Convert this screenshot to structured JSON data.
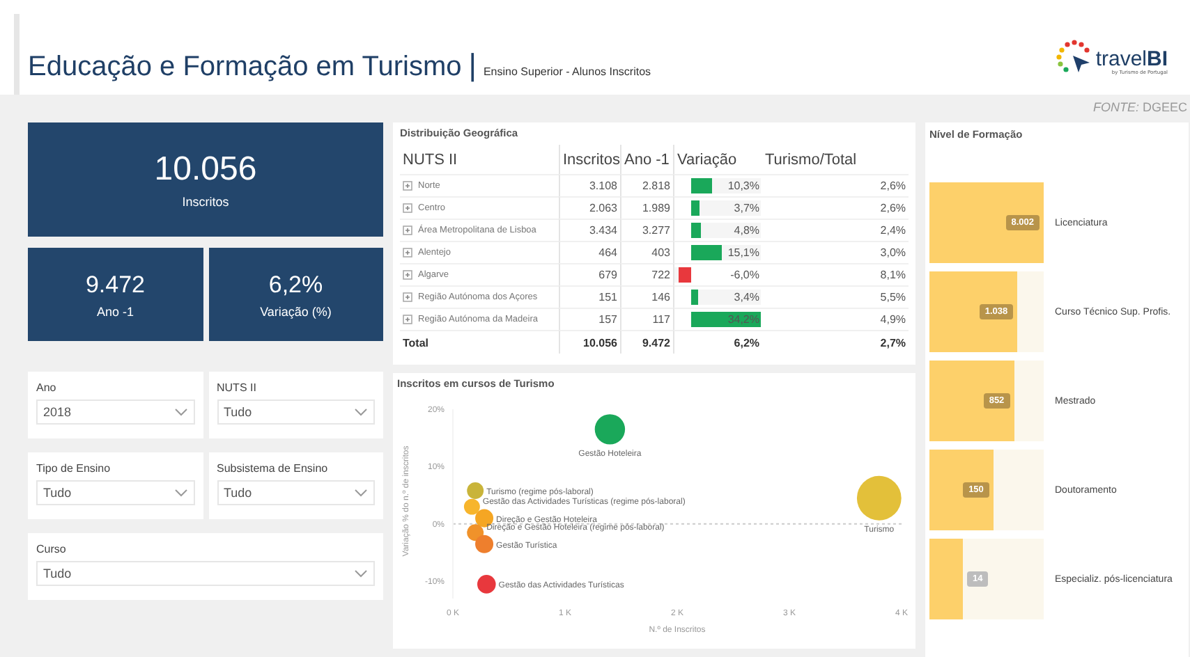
{
  "header": {
    "title": "Educação e Formação em Turismo",
    "separator": "|",
    "subtitle": "Ensino Superior - Alunos Inscritos",
    "logo": "travel**BI**",
    "logo_tagline": "by Turismo de Portugal",
    "source": "*FONTE:* DGEEC"
  },
  "kpis": {
    "main": {
      "value": "10.056",
      "label": "Inscritos"
    },
    "small": [
      {
        "value": "9.472",
        "label": "Ano -1"
      },
      {
        "value": "6,2%",
        "label": "Variação (%)"
      }
    ]
  },
  "filters": [
    {
      "label": "Ano",
      "value": "2018",
      "wide": false
    },
    {
      "label": "NUTS II",
      "value": "Tudo",
      "wide": false
    },
    {
      "label": "Tipo de Ensino",
      "value": "Tudo",
      "wide": false
    },
    {
      "label": "Subsistema de Ensino",
      "value": "Tudo",
      "wide": false
    },
    {
      "label": "Curso",
      "value": "Tudo",
      "wide": true
    }
  ],
  "geo_table": {
    "title": "Distribuição Geográfica",
    "columns": [
      "NUTS II",
      "Inscritos",
      "Ano -1",
      "Variação",
      "Turismo/Total"
    ],
    "rows": [
      {
        "name": "Norte",
        "inscritos": "3.108",
        "ano_anterior": "2.818",
        "variacao": "10,3%",
        "level": 0.3,
        "negative": false,
        "turismo_total": "2,6%"
      },
      {
        "name": "Centro",
        "inscritos": "2.063",
        "ano_anterior": "1.989",
        "variacao": "3,7%",
        "level": 0.11,
        "negative": false,
        "turismo_total": "2,6%"
      },
      {
        "name": "Área Metropolitana de Lisboa",
        "inscritos": "3.434",
        "ano_anterior": "3.277",
        "variacao": "4,8%",
        "level": 0.14,
        "negative": false,
        "turismo_total": "2,4%"
      },
      {
        "name": "Alentejo",
        "inscritos": "464",
        "ano_anterior": "403",
        "variacao": "15,1%",
        "level": 0.44,
        "negative": false,
        "turismo_total": "3,0%"
      },
      {
        "name": "Algarve",
        "inscritos": "679",
        "ano_anterior": "722",
        "variacao": "-6,0%",
        "level": 0.75,
        "negative": true,
        "turismo_total": "8,1%"
      },
      {
        "name": "Região Autónoma dos Açores",
        "inscritos": "151",
        "ano_anterior": "146",
        "variacao": "3,4%",
        "level": 0.1,
        "negative": false,
        "turismo_total": "5,5%"
      },
      {
        "name": "Região Autónoma da Madeira",
        "inscritos": "157",
        "ano_anterior": "117",
        "variacao": "34,2%",
        "level": 1,
        "negative": false,
        "turismo_total": "4,9%"
      }
    ],
    "total": {
      "name": "Total",
      "inscritos": "10.056",
      "ano_anterior": "9.472",
      "variacao": "6,2%",
      "turismo_total": "2,7%"
    }
  },
  "scatter": {
    "chart_data": {
      "type": "scatter",
      "title": "Inscritos em cursos de Turismo",
      "xlabel": "N.º de Inscritos",
      "ylabel": "Variação % do n.º de inscritos",
      "x": [
        1400,
        3800,
        200,
        170,
        280,
        200,
        280,
        300
      ],
      "series": [
        {
          "name": "Gestão Hoteleira",
          "color": "#1aa85a",
          "values": [
            16.5,
            null,
            null,
            null,
            null,
            null,
            null,
            null
          ]
        },
        {
          "name": "Turismo",
          "color": "#e3c03a",
          "values": [
            null,
            4.5,
            null,
            null,
            null,
            null,
            null,
            null
          ]
        },
        {
          "name": "Turismo (regime pós-laboral)",
          "color": "#c9b43a",
          "values": [
            null,
            null,
            5.8,
            null,
            null,
            null,
            null,
            null
          ]
        },
        {
          "name": "Gestão das Actividades Turísticas (regime pós-laboral)",
          "color": "#f7b52c",
          "values": [
            null,
            null,
            null,
            3,
            null,
            null,
            null,
            null
          ]
        },
        {
          "name": "Direção e Gestão Hoteleira",
          "color": "#f5a623",
          "values": [
            null,
            null,
            null,
            null,
            1,
            null,
            null,
            null
          ]
        },
        {
          "name": "Direção e Gestão Hoteleira (regime pós-laboral)",
          "color": "#f0922a",
          "values": [
            null,
            null,
            null,
            null,
            null,
            -1.5,
            null,
            null
          ]
        },
        {
          "name": "Gestão Turística",
          "color": "#ee7f2d",
          "values": [
            null,
            null,
            null,
            null,
            null,
            null,
            -3.5,
            null
          ]
        },
        {
          "name": "Gestão das Actividades Turísticas",
          "color": "#e8383d",
          "values": [
            null,
            null,
            null,
            null,
            null,
            null,
            null,
            -10.5
          ]
        }
      ],
      "xlim": [
        0,
        4000
      ],
      "ylim": [
        -13,
        20
      ],
      "xticks": [
        {
          "value": 0,
          "label": "0 K"
        },
        {
          "value": 1000,
          "label": "1 K"
        },
        {
          "value": 2000,
          "label": "2 K"
        },
        {
          "value": 3000,
          "label": "3 K"
        },
        {
          "value": 4000,
          "label": "4 K"
        }
      ],
      "yticks": [
        {
          "value": -10,
          "label": "-10%"
        },
        {
          "value": 0,
          "label": "0%"
        },
        {
          "value": 10,
          "label": "10%"
        },
        {
          "value": 20,
          "label": "20%"
        }
      ]
    }
  },
  "levels": {
    "title": "Nível de Formação",
    "items": [
      {
        "label": "Licenciatura",
        "value": "8.002",
        "level": 1
      },
      {
        "label": "Curso Técnico Sup. Profis.",
        "value": "1.038",
        "level": 0.77
      },
      {
        "label": "Mestrado",
        "value": "852",
        "level": 0.74
      },
      {
        "label": "Doutoramento",
        "value": "150",
        "level": 0.56
      },
      {
        "label": "Especializ. pós-licenciatura",
        "value": "14",
        "level": 0.29
      }
    ]
  }
}
